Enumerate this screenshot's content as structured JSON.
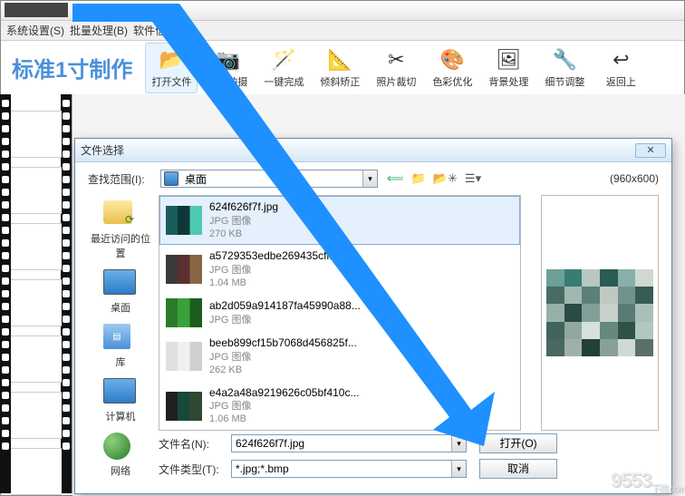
{
  "menu": {
    "sys": "系统设置(S)",
    "batch": "批量处理(B)",
    "info": "软件信息(H)"
  },
  "app_title": "标准1寸制作",
  "toolbar": [
    {
      "label": "打开文件",
      "active": true
    },
    {
      "label": "联机拍摄"
    },
    {
      "label": "一键完成"
    },
    {
      "label": "倾斜矫正"
    },
    {
      "label": "照片裁切"
    },
    {
      "label": "色彩优化"
    },
    {
      "label": "背景处理"
    },
    {
      "label": "细节调整"
    },
    {
      "label": "返回上"
    }
  ],
  "dialog": {
    "title": "文件选择",
    "look_in_label": "查找范围(I):",
    "look_in_value": "桌面",
    "dims": "(960x600)",
    "places": [
      {
        "label": "最近访问的位置"
      },
      {
        "label": "桌面"
      },
      {
        "label": "库"
      },
      {
        "label": "计算机"
      },
      {
        "label": "网络"
      }
    ],
    "files": [
      {
        "name": "624f626f7f.jpg",
        "type": "JPG 图像",
        "size": "270 KB",
        "selected": true,
        "thumb_colors": [
          "#1a5c5c",
          "#0e3838",
          "#4ec9b0"
        ]
      },
      {
        "name": "a5729353edbe269435cffb...",
        "type": "JPG 图像",
        "size": "1.04 MB",
        "thumb_colors": [
          "#3a3a3a",
          "#5a3030",
          "#886644"
        ]
      },
      {
        "name": "ab2d059a914187fa45990a88...",
        "type": "JPG 图像",
        "size": "",
        "thumb_colors": [
          "#2a7c2a",
          "#3aa03a",
          "#1e5c1e"
        ]
      },
      {
        "name": "beeb899cf15b7068d456825f...",
        "type": "JPG 图像",
        "size": "262 KB",
        "thumb_colors": [
          "#e0e0e0",
          "#f0f0f0",
          "#d0d0d0"
        ]
      },
      {
        "name": "e4a2a48a9219626c05bf410c...",
        "type": "JPG 图像",
        "size": "1.06 MB",
        "thumb_colors": [
          "#202020",
          "#184838",
          "#304830"
        ]
      }
    ],
    "filename_label": "文件名(N):",
    "filename_value": "624f626f7f.jpg",
    "filetype_label": "文件类型(T):",
    "filetype_value": "*.jpg;*.bmp",
    "open_btn": "打开(O)",
    "cancel_btn": "取消"
  },
  "watermark": "9553",
  "watermark_sub": "下载.com"
}
